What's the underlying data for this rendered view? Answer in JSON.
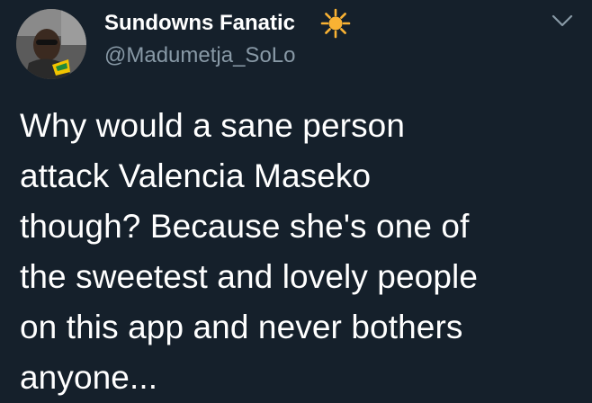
{
  "tweet": {
    "author": {
      "display_name": "Sundowns Fanatic",
      "name_emoji": "sun-icon",
      "handle": "@Madumetja_SoLo",
      "avatar": "avatar"
    },
    "menu_icon": "chevron-down-icon",
    "text": "Why would a sane person\nattack Valencia Maseko\nthough? Because she's one of\nthe sweetest and lovely people\non this app and never bothers\nanyone..."
  },
  "colors": {
    "background": "#15202b",
    "name": "#ffffff",
    "handle": "#8899a6",
    "body_text": "#ffffff",
    "sun": "#f9b233",
    "chevron": "#8899a6"
  }
}
